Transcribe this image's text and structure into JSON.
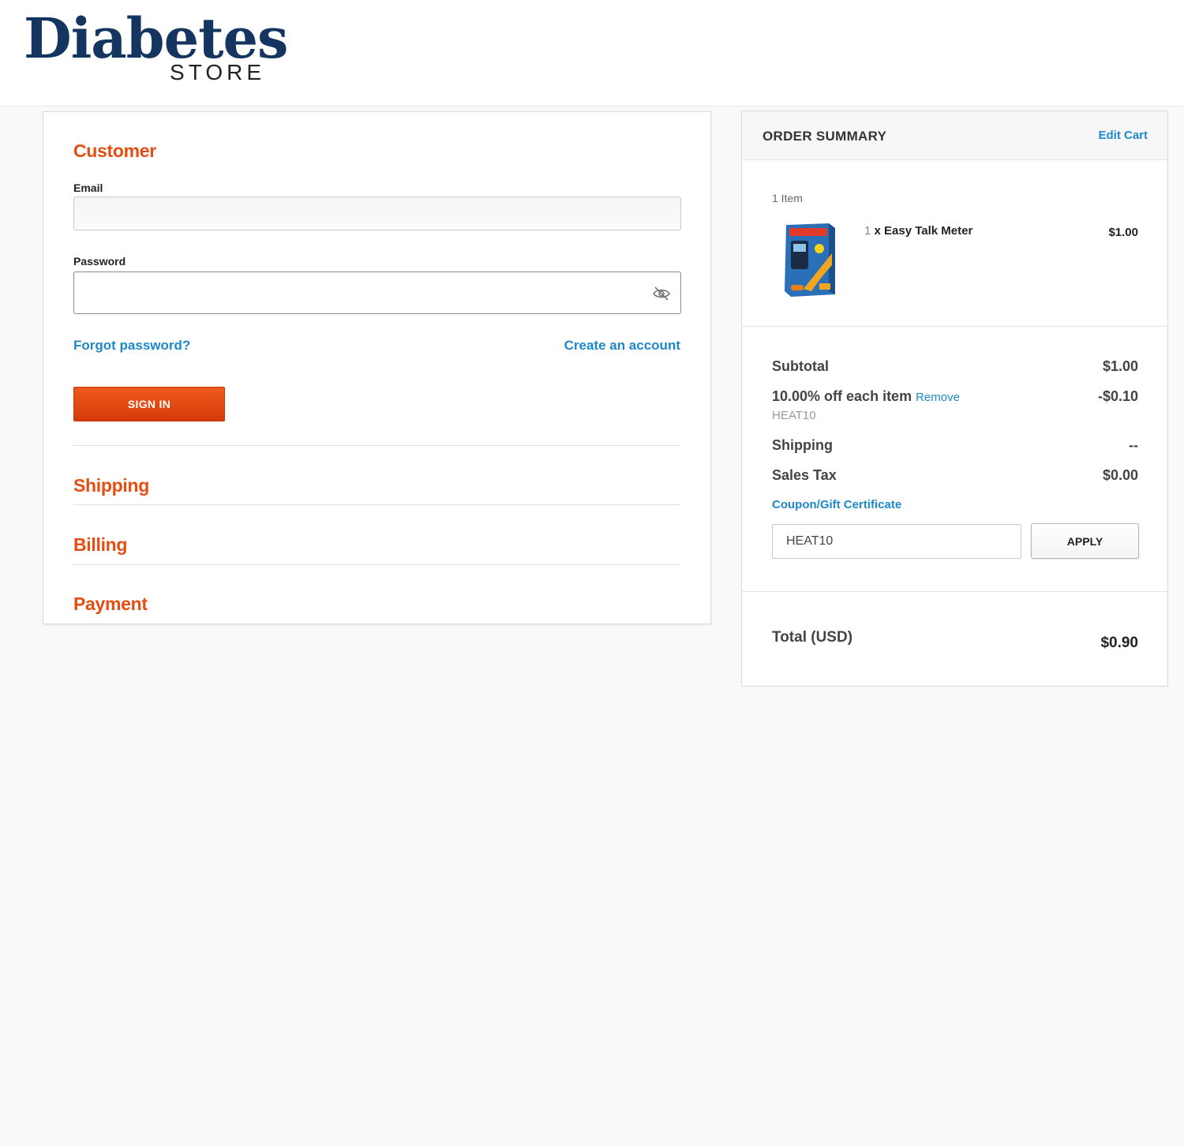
{
  "brand": {
    "logo_main": "Diabetes",
    "logo_sub": "STORE",
    "colors": {
      "navy": "#13355f",
      "orange": "#e44e13",
      "link": "#1e88c8"
    }
  },
  "customer": {
    "title": "Customer",
    "email_label": "Email",
    "email_value": "",
    "password_label": "Password",
    "password_value": "",
    "forgot_link": "Forgot password?",
    "create_link": "Create an account",
    "signin_label": "SIGN IN"
  },
  "steps": {
    "shipping": "Shipping",
    "billing": "Billing",
    "payment": "Payment"
  },
  "summary": {
    "title": "ORDER SUMMARY",
    "edit_cart": "Edit Cart",
    "items_count": "1 Item",
    "item": {
      "qty": "1",
      "name": "x Easy Talk Meter",
      "price": "$1.00",
      "image_icon": "product-box-icon"
    },
    "subtotal_label": "Subtotal",
    "subtotal_value": "$1.00",
    "discount_label": "10.00% off each item",
    "discount_remove": "Remove",
    "discount_value": "-$0.10",
    "discount_code": "HEAT10",
    "shipping_label": "Shipping",
    "shipping_value": "--",
    "tax_label": "Sales Tax",
    "tax_value": "$0.00",
    "coupon_link": "Coupon/Gift Certificate",
    "coupon_input_value": "HEAT10",
    "apply_label": "APPLY",
    "total_label": "Total (USD)",
    "total_value": "$0.90"
  }
}
